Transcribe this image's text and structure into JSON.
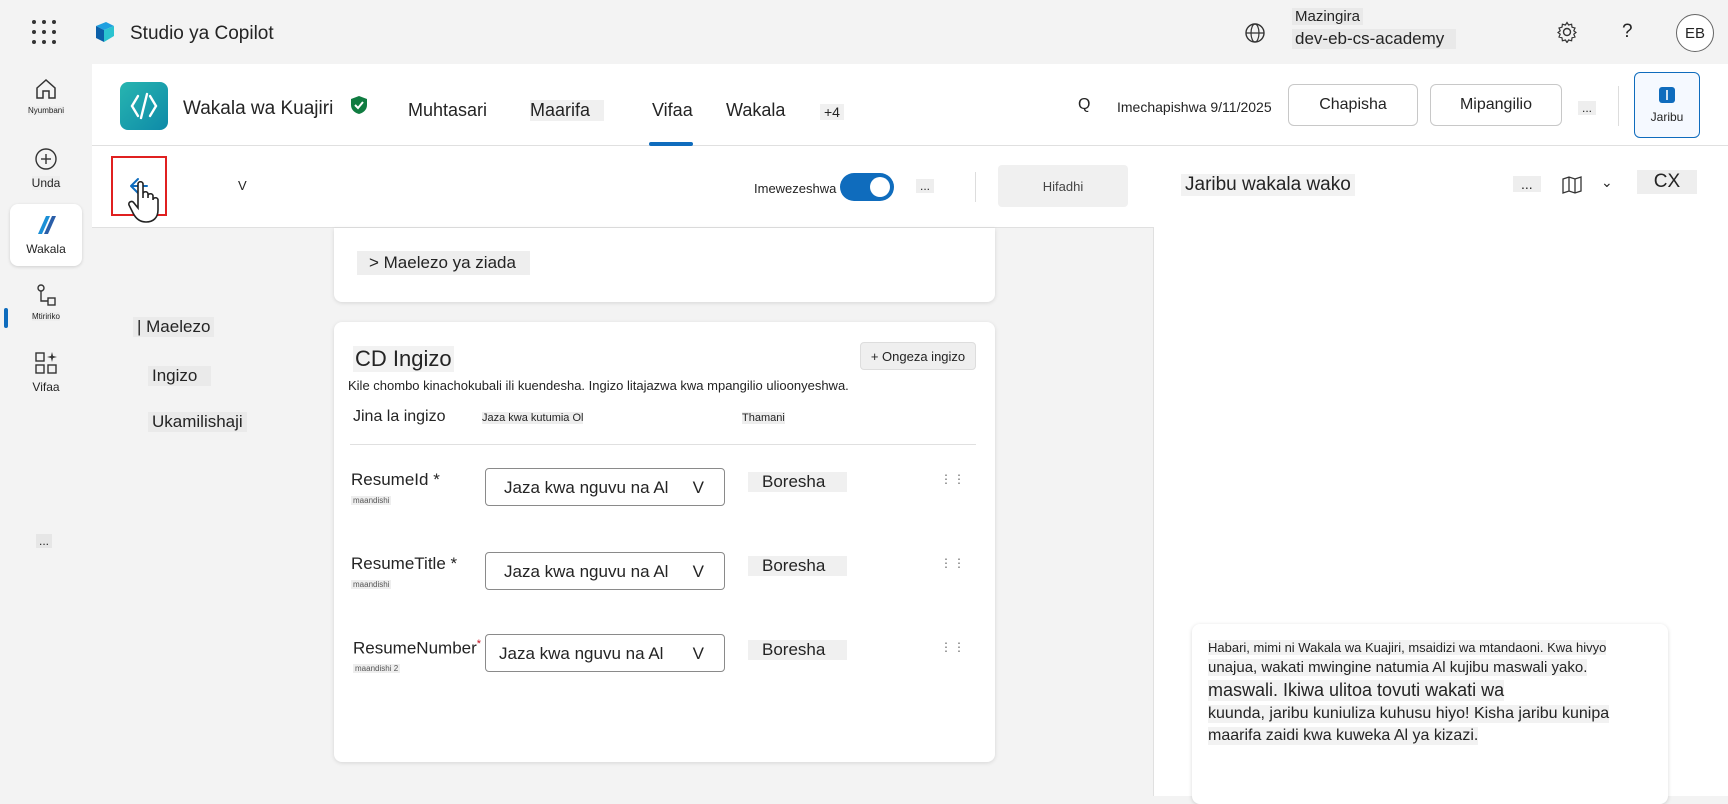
{
  "app": {
    "title": "Studio ya Copilot",
    "environment_label": "Mazingira",
    "environment_value": "dev-eb-cs-academy",
    "avatar_initials": "EB",
    "help_glyph": "?"
  },
  "leftnav": {
    "items": [
      {
        "label": "Nyumbani",
        "icon": "home-icon"
      },
      {
        "label": "Unda",
        "icon": "plus-circle-icon"
      },
      {
        "label": "Wakala",
        "icon": "agent-icon"
      },
      {
        "label": "Mtiririko",
        "icon": "flow-icon"
      },
      {
        "label": "Vifaa",
        "icon": "tools-icon"
      }
    ],
    "more_label": "...",
    "selected": "Wakala"
  },
  "agent": {
    "name": "Wakala wa Kuajiri",
    "tabs": [
      "Muhtasari",
      "Maarifa",
      "Vifaa",
      "Wakala",
      "+4"
    ],
    "active_tab": "Vifaa",
    "search_glyph": "Q",
    "published_text": "Imechapishwa 9/11/2025",
    "publish_button": "Chapisha",
    "settings_button": "Mipangilio",
    "more_button": "...",
    "test_button": "Jaribu"
  },
  "tool": {
    "version_label": "V",
    "enabled_label": "Imewezeshwa",
    "enabled": true,
    "more_label": "...",
    "save_label": "Hifadhi",
    "sidenav": [
      "| Maelezo",
      "Ingizo",
      "Ukamilishaji"
    ],
    "details_toggle": "> Maelezo ya ziada",
    "inputs": {
      "title": "CD Ingizo",
      "add_button": "+ Ongeza ingizo",
      "description": "Kile chombo kinachokubali ili kuendesha. Ingizo litajazwa kwa mpangilio ulioonyeshwa.",
      "columns": [
        "Jina la ingizo",
        "Jaza kwa kutumia Ol",
        "Thamani"
      ],
      "rows": [
        {
          "name": "ResumeId *",
          "sub": "maandishi",
          "fill": "Jaza kwa nguvu na Al",
          "chevron": "V",
          "value": "Boresha"
        },
        {
          "name": "ResumeTitle *",
          "sub": "maandishi",
          "fill": "Jaza kwa nguvu na Al",
          "chevron": "V",
          "value": "Boresha"
        },
        {
          "name": "ResumeNumber",
          "required_mark": "*",
          "sub": "maandishi 2",
          "fill": "Jaza kwa nguvu na Al",
          "chevron": "V",
          "value": "Boresha"
        }
      ]
    }
  },
  "test_panel": {
    "title": "Jaribu wakala wako",
    "more_label": "...",
    "chevron": "⌄",
    "cx_label": "CX",
    "message_lines": [
      "Habari, mimi ni Wakala wa Kuajiri, msaidizi wa mtandaoni. Kwa hivyo",
      "unajua, wakati mwingine natumia Al kujibu maswali yako.",
      "maswali. Ikiwa ulitoa tovuti wakati wa",
      "kuunda, jaribu kuniuliza kuhusu hiyo! Kisha jaribu kunipa",
      "maarifa zaidi kwa kuweka Al ya kizazi."
    ]
  },
  "colors": {
    "accent": "#0f6cbd",
    "highlight_box": "#e02020",
    "verified": "#107c41"
  }
}
